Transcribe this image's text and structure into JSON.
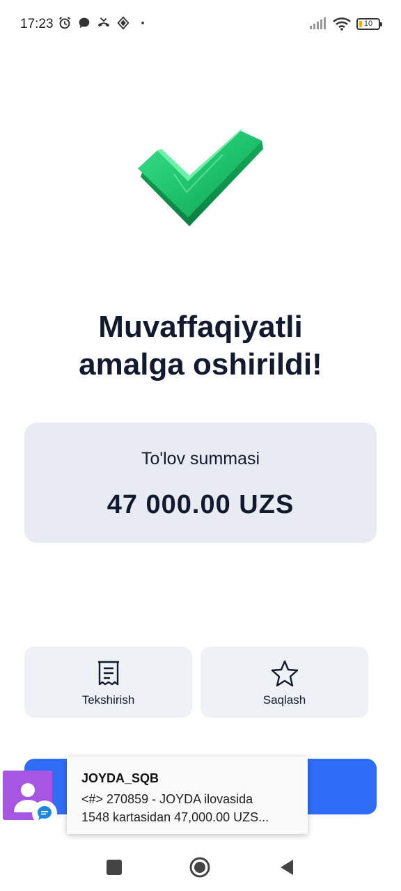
{
  "status_bar": {
    "time": "17:23",
    "battery_level": "10",
    "icons_left": [
      "alarm-icon",
      "chat-bubble-icon",
      "missed-call-icon",
      "app-notification-icon",
      "dot-icon"
    ],
    "icons_right": [
      "signal-icon",
      "wifi-icon",
      "battery-icon"
    ]
  },
  "success": {
    "title_line1": "Muvaffaqiyatli",
    "title_line2": "amalga oshirildi!",
    "icon": "check-icon",
    "accent_color": "#1fc46e"
  },
  "payment": {
    "label": "To'lov summasi",
    "amount": "47 000.00 UZS"
  },
  "actions": [
    {
      "label": "Tekshirish",
      "icon": "receipt-icon"
    },
    {
      "label": "Saqlash",
      "icon": "star-icon"
    }
  ],
  "primary_button": {
    "color": "#2f6df6"
  },
  "notification": {
    "sender": "JOYDA_SQB",
    "line1": "<#> 270859 - JOYDA ilovasida",
    "line2": "1548 kartasidan 47,000.00 UZS..."
  },
  "nav": [
    "recents-button",
    "home-button",
    "back-button"
  ]
}
